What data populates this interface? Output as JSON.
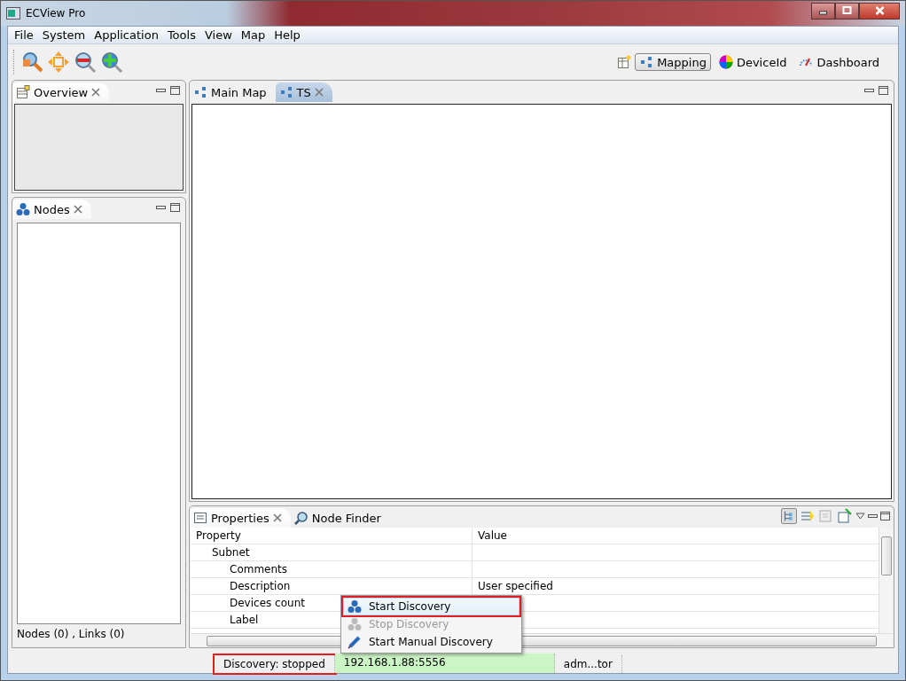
{
  "window": {
    "title": "ECView Pro"
  },
  "menu": [
    {
      "label": "File"
    },
    {
      "label": "System"
    },
    {
      "label": "Application"
    },
    {
      "label": "Tools"
    },
    {
      "label": "View"
    },
    {
      "label": "Map"
    },
    {
      "label": "Help"
    }
  ],
  "perspectives": [
    {
      "label": "Mapping",
      "selected": true,
      "kind": "mapping"
    },
    {
      "label": "DeviceId",
      "selected": false,
      "kind": "deviceid"
    },
    {
      "label": "Dashboard",
      "selected": false,
      "kind": "dashboard"
    }
  ],
  "overview": {
    "tab": "Overview"
  },
  "nodes": {
    "tab": "Nodes",
    "footer": "Nodes (0) , Links (0)"
  },
  "editor_tabs": [
    {
      "label": "Main Map",
      "selected": false,
      "closable": false
    },
    {
      "label": "TS",
      "selected": true,
      "closable": true
    }
  ],
  "properties": {
    "tabs": [
      {
        "label": "Properties",
        "selected": true,
        "kind": "properties"
      },
      {
        "label": "Node Finder",
        "selected": false,
        "kind": "finder"
      }
    ],
    "columns": [
      "Property",
      "Value"
    ],
    "rows": [
      {
        "name": "Subnet",
        "children": [
          {
            "name": "Comments"
          },
          {
            "name": "Description",
            "value": "User specified"
          },
          {
            "name": "Devices count"
          },
          {
            "name": "Label"
          }
        ]
      }
    ]
  },
  "context_menu": [
    {
      "label": "Start Discovery",
      "kind": "start",
      "selected": true,
      "disabled": false,
      "highlighted": true
    },
    {
      "label": "Stop Discovery",
      "kind": "stop",
      "selected": false,
      "disabled": true,
      "highlighted": false
    },
    {
      "label": "Start Manual Discovery",
      "kind": "manual",
      "selected": false,
      "disabled": false,
      "highlighted": false
    }
  ],
  "status_bar": [
    {
      "text": "Discovery: stopped",
      "kind": "plain",
      "highlighted": true
    },
    {
      "text": "192.168.1.88:5556",
      "kind": "connection",
      "highlighted": false
    },
    {
      "text": "adm...tor",
      "kind": "plain",
      "highlighted": false
    }
  ]
}
